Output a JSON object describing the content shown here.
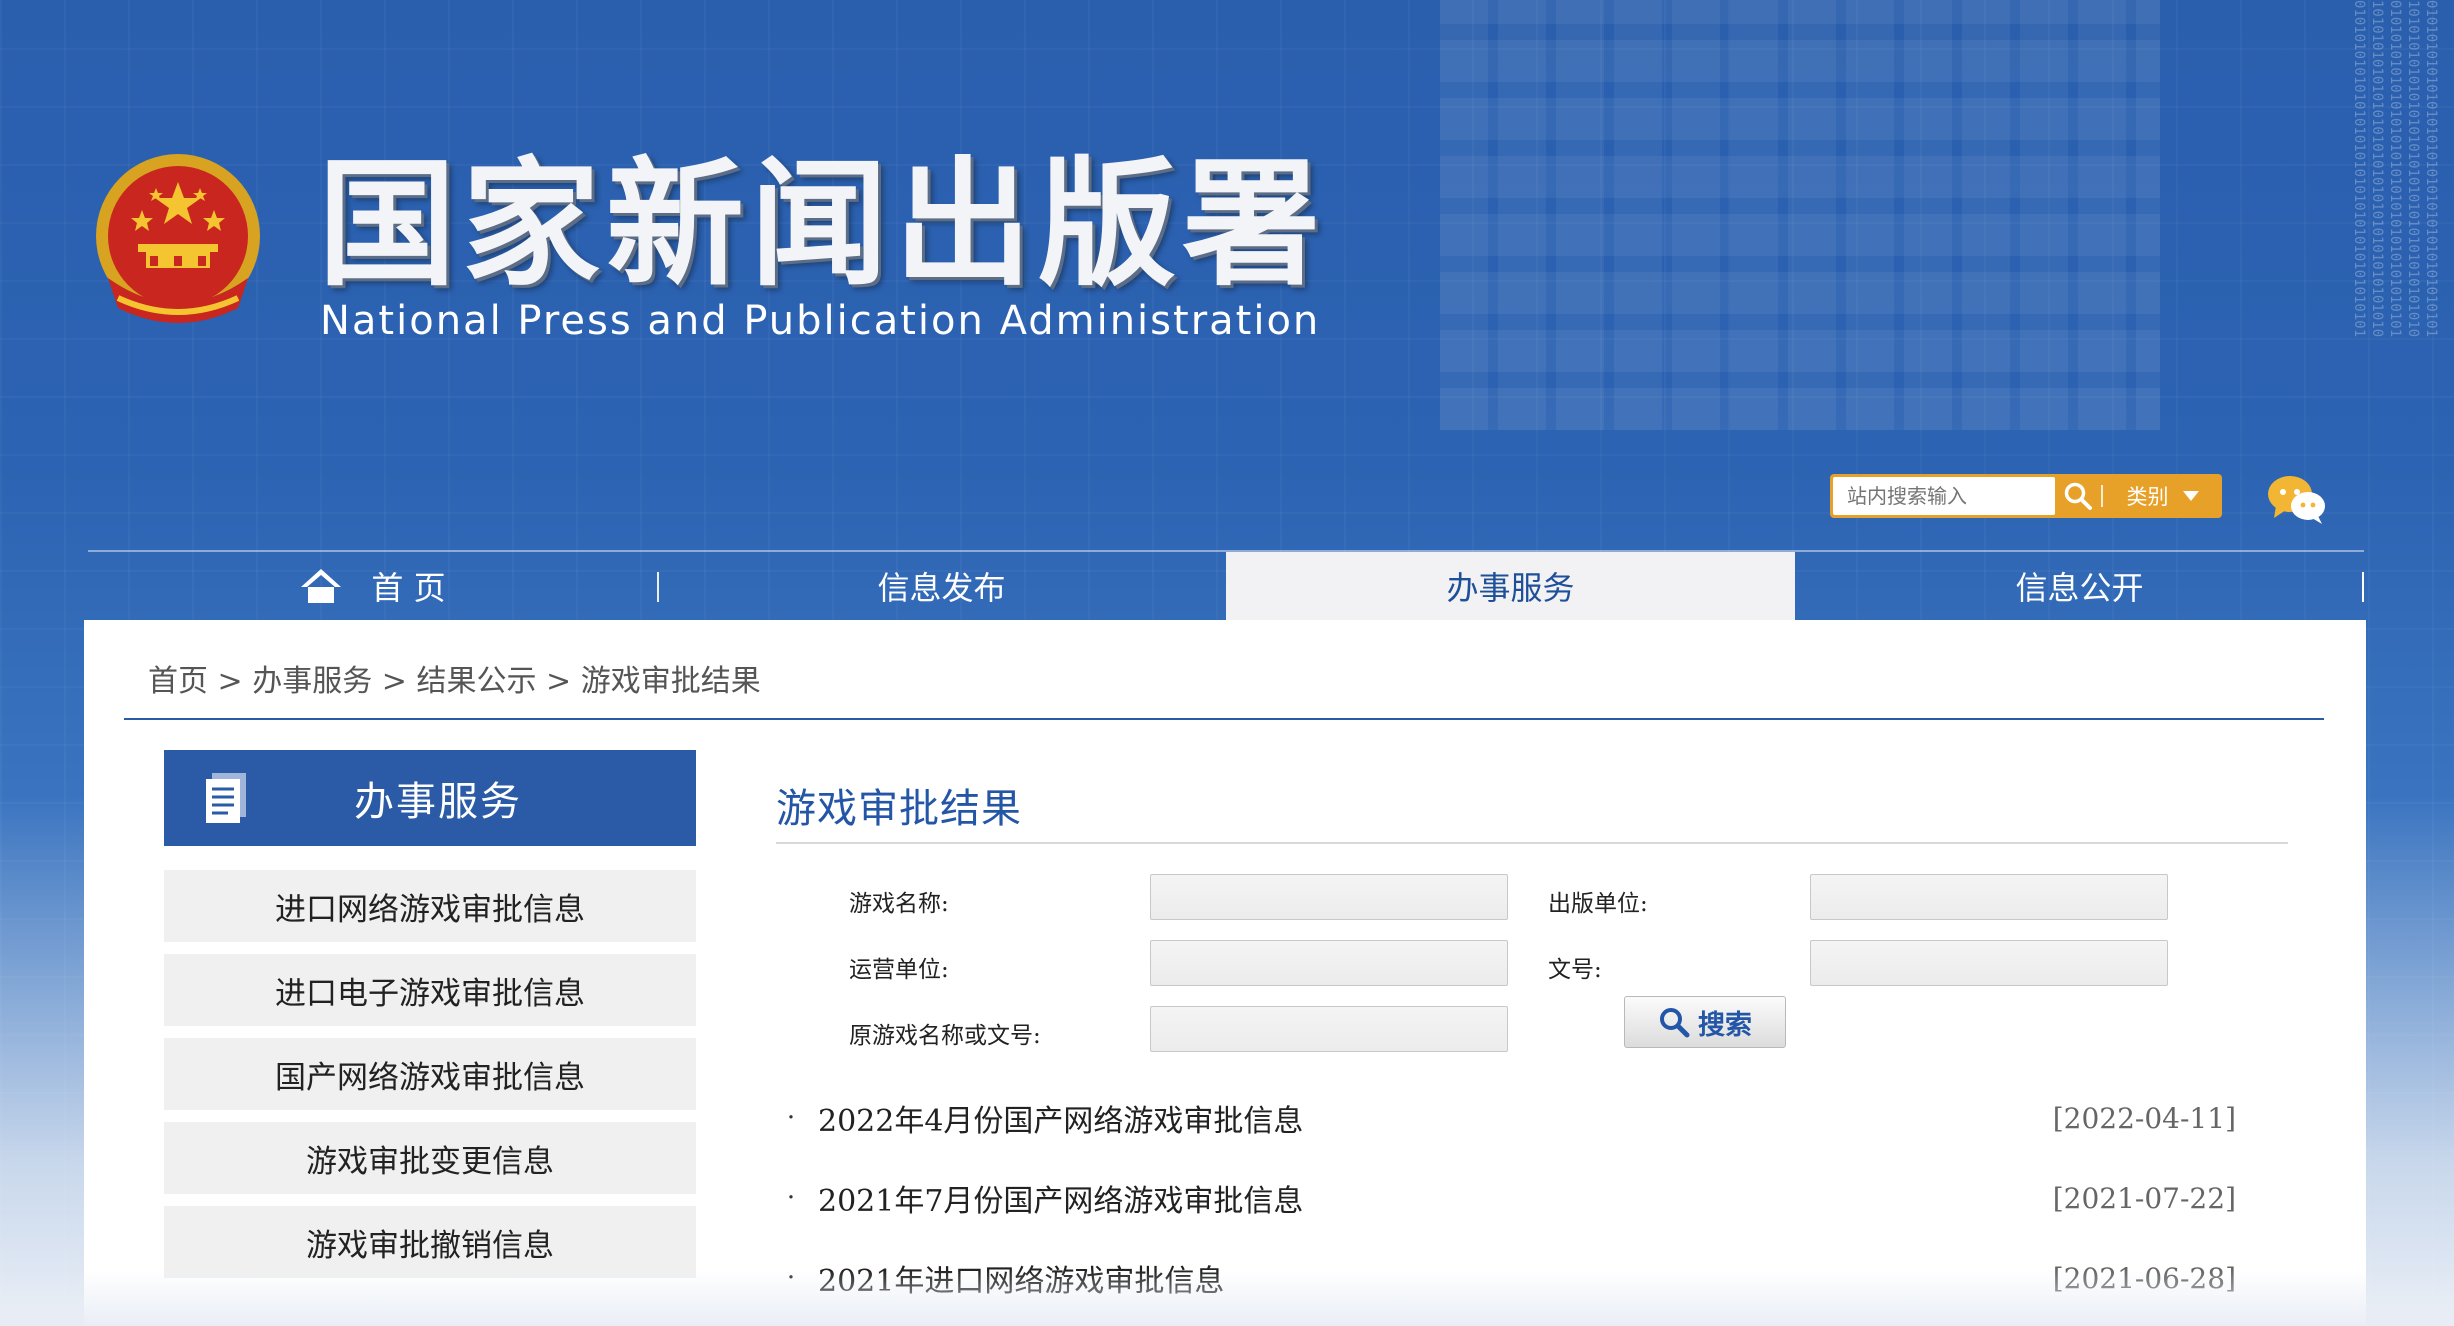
{
  "header": {
    "title": "国家新闻出版署",
    "subtitle": "National  Press and Publication Administration"
  },
  "search": {
    "placeholder": "站内搜索输入",
    "category_label": "类别"
  },
  "nav": {
    "items": [
      {
        "label": "首 页",
        "icon": "home-icon"
      },
      {
        "label": "信息发布"
      },
      {
        "label": "办事服务",
        "active": true
      },
      {
        "label": "信息公开"
      }
    ]
  },
  "breadcrumb": {
    "home": "首页",
    "sep": ">",
    "level1": "办事服务",
    "level2": "结果公示",
    "current": "游戏审批结果"
  },
  "sidebar": {
    "title": "办事服务",
    "items": [
      {
        "label": "进口网络游戏审批信息"
      },
      {
        "label": "进口电子游戏审批信息"
      },
      {
        "label": "国产网络游戏审批信息"
      },
      {
        "label": "游戏审批变更信息"
      },
      {
        "label": "游戏审批撤销信息"
      }
    ]
  },
  "content": {
    "title": "游戏审批结果",
    "form": {
      "game_name_label": "游戏名称:",
      "publisher_label": "出版单位:",
      "operator_label": "运营单位:",
      "doc_no_label": "文号:",
      "original_label": "原游戏名称或文号:",
      "search_button": "搜索"
    },
    "results": [
      {
        "title": "2022年4月份国产网络游戏审批信息",
        "date": "[2022-04-11]"
      },
      {
        "title": "2021年7月份国产网络游戏审批信息",
        "date": "[2021-07-22]"
      },
      {
        "title": "2021年进口网络游戏审批信息",
        "date": "[2021-06-28]"
      }
    ]
  },
  "colors": {
    "brand_blue": "#2b5ba6",
    "title_blue": "#2356a6",
    "search_orange": "#e8a128"
  }
}
